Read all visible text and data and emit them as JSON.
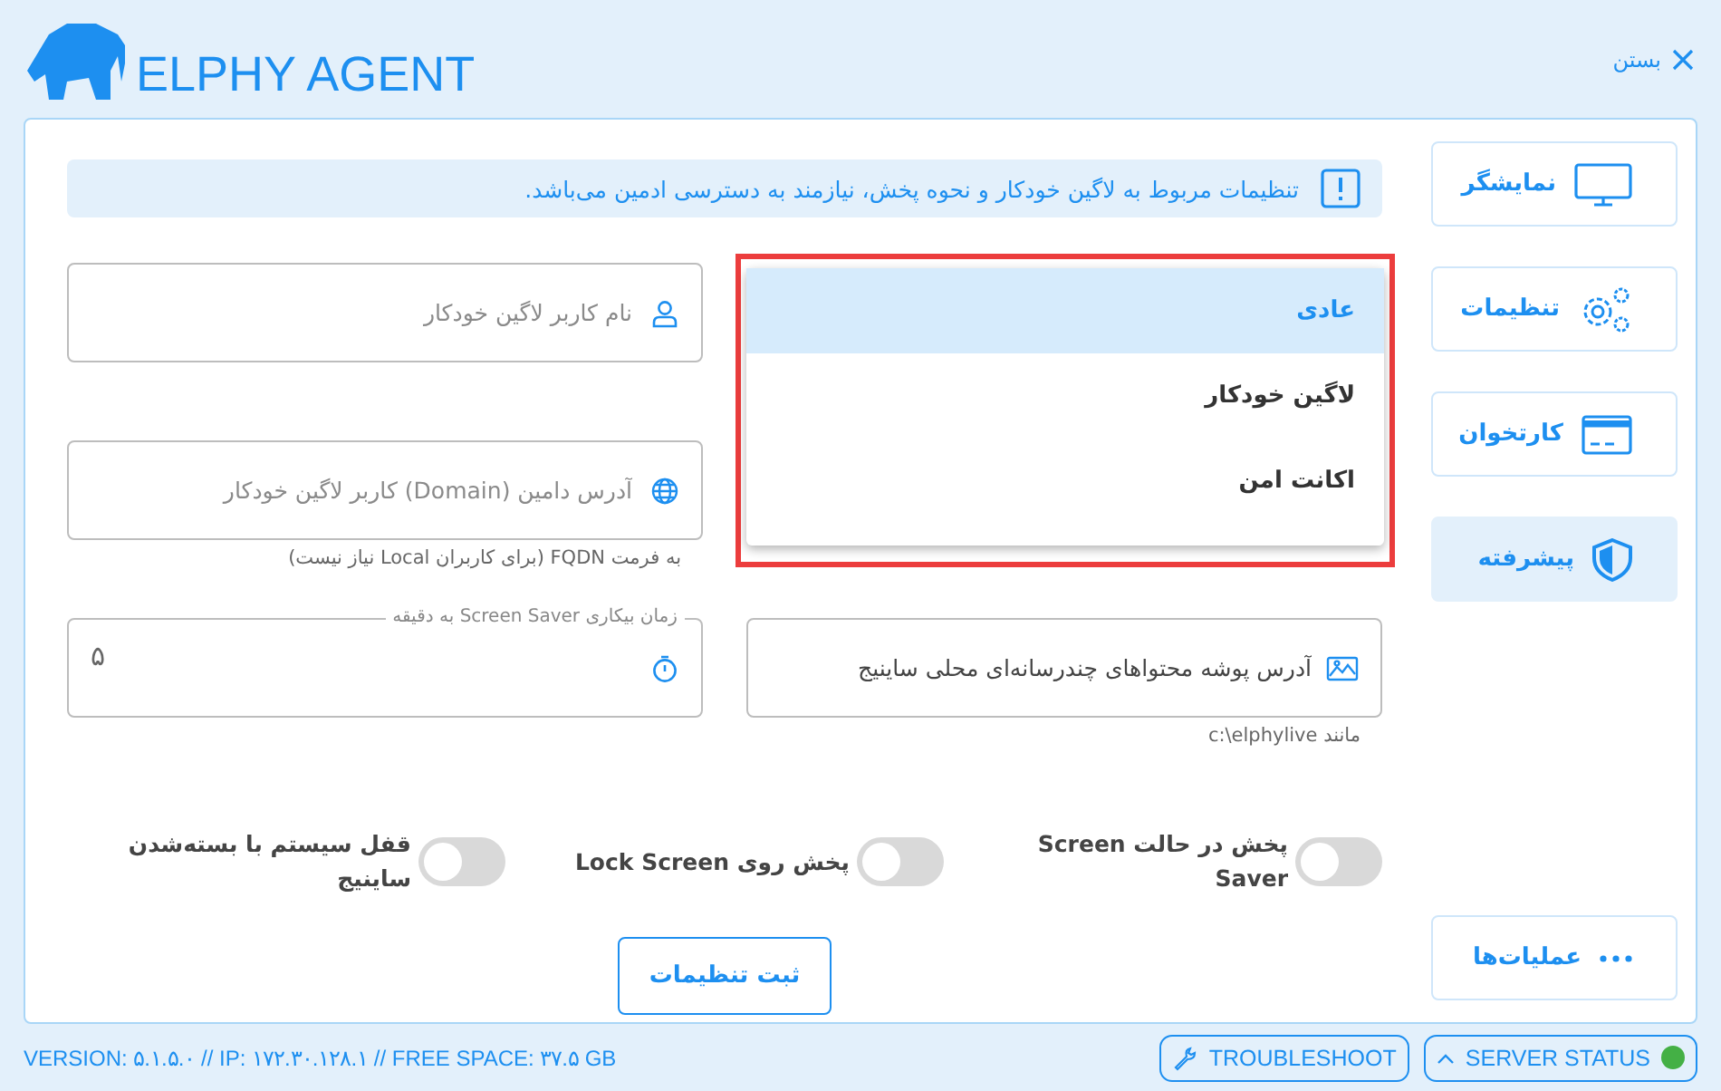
{
  "header": {
    "logo": "ELPHY AGENT",
    "close": "بستن"
  },
  "notice": "تنظیمات مربوط به لاگین خودکار و نحوه پخش، نیازمند به دسترسی ادمین می‌باشد.",
  "fields": [
    {
      "kind": "user",
      "placeholder": "نام کاربر لاگین خودکار"
    },
    {
      "kind": "globe",
      "placeholder": "آدرس دامین (Domain) کاربر لاگین خودکار",
      "hint": "به فرمت FQDN (برای کاربران Local نیاز نیست)"
    },
    {
      "kind": "timer",
      "label": "زمان بیکاری Screen Saver به دقیقه",
      "value": "۵"
    },
    {
      "kind": "image",
      "placeholder": "آدرس پوشه محتواهای چندرسانه‌ای محلی ساینیج",
      "hint": "مانند c:\\elphylive"
    }
  ],
  "dropdown": {
    "options": [
      {
        "label": "عادی",
        "selected": true
      },
      {
        "label": "لاگین خودکار",
        "selected": false
      },
      {
        "label": "اکانت امن",
        "selected": false
      }
    ]
  },
  "toggles": [
    {
      "label": "پخش در حالت Screen Saver",
      "on": false
    },
    {
      "label": "پخش روی Lock Screen",
      "on": false
    },
    {
      "label": "قفل سیستم با بسته‌شدن ساینیج",
      "on": false
    }
  ],
  "save_button": "ثبت تنظیمات",
  "nav": [
    {
      "label": "نمایشگر",
      "kind": "monitor",
      "selected": false
    },
    {
      "label": "تنظیمات",
      "kind": "gears",
      "selected": false
    },
    {
      "label": "کارتخوان",
      "kind": "card",
      "selected": false
    },
    {
      "label": "پیشرفته",
      "kind": "shield",
      "selected": true
    }
  ],
  "actions_button": "عملیات‌ها",
  "status_bar": {
    "info": "VERSION: ۵.۱.۵.۰ // IP: ۱۷۲.۳۰.۱۲۸.۱ // FREE SPACE: ۳۷.۵ GB",
    "troubleshoot": "TROUBLESHOOT",
    "server_status": "SERVER STATUS",
    "server_online": true
  }
}
